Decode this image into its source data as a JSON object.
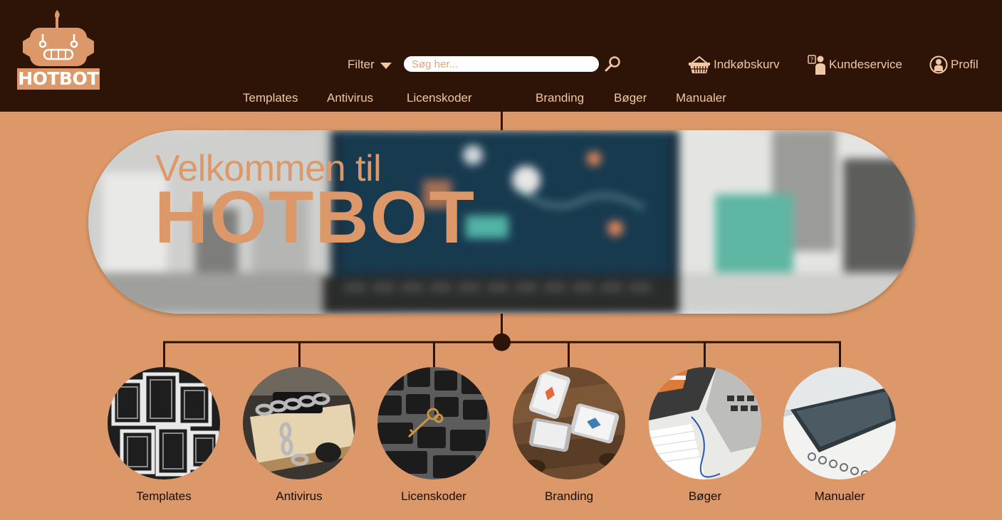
{
  "brand": {
    "name": "HOTBOT"
  },
  "header": {
    "filter_label": "Filter",
    "search_placeholder": "Søg her...",
    "basket_label": "Indkøbskurv",
    "service_label": "Kundeservice",
    "profile_label": "Profil"
  },
  "nav": {
    "items": [
      {
        "label": "Templates"
      },
      {
        "label": "Antivirus"
      },
      {
        "label": "Licenskoder"
      },
      {
        "label": "Branding"
      },
      {
        "label": "Bøger"
      },
      {
        "label": "Manualer"
      }
    ]
  },
  "banner": {
    "line1": "Velkommen til",
    "line2": "HOTBOT"
  },
  "categories": [
    {
      "label": "Templates",
      "image": "picture-frames-photo"
    },
    {
      "label": "Antivirus",
      "image": "chained-book-and-phone-photo"
    },
    {
      "label": "Licenskoder",
      "image": "key-on-keyboard-photo"
    },
    {
      "label": "Branding",
      "image": "phones-on-table-photo"
    },
    {
      "label": "Bøger",
      "image": "laptop-and-notebook-photo"
    },
    {
      "label": "Manualer",
      "image": "tablet-on-notebook-photo"
    }
  ],
  "colors": {
    "header_bg": "#2e1407",
    "page_bg": "#dc9868",
    "accent": "#dc9868",
    "header_text": "#f0c6a4",
    "body_text": "#1b0c05"
  }
}
